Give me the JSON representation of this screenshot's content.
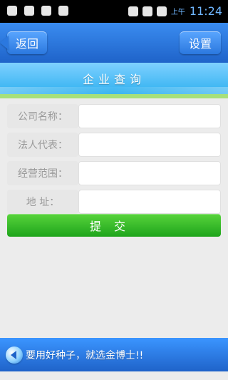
{
  "status_bar": {
    "ampm": "上午",
    "time": "11:24"
  },
  "header": {
    "back_label": "返回",
    "settings_label": "设置",
    "page_title": "企业查询"
  },
  "form": {
    "fields": [
      {
        "label": "公司名称：",
        "value": ""
      },
      {
        "label": "法人代表：",
        "value": ""
      },
      {
        "label": "经营范围：",
        "value": ""
      },
      {
        "label": "地    址：",
        "value": ""
      }
    ],
    "submit_label": "提交"
  },
  "footer": {
    "slogan": "要用好种子，就选金博士!!"
  },
  "colors": {
    "header_blue": "#2b78df",
    "banner_blue": "#2fb1f0",
    "submit_green": "#1ea41b"
  },
  "icons": {
    "usb": "usb-icon",
    "android": "android-icon",
    "shield": "shield-icon",
    "notifications": "notification-icon",
    "alarm": "alarm-icon",
    "signal": "signal-icon",
    "battery": "battery-icon",
    "speaker": "speaker-icon"
  }
}
